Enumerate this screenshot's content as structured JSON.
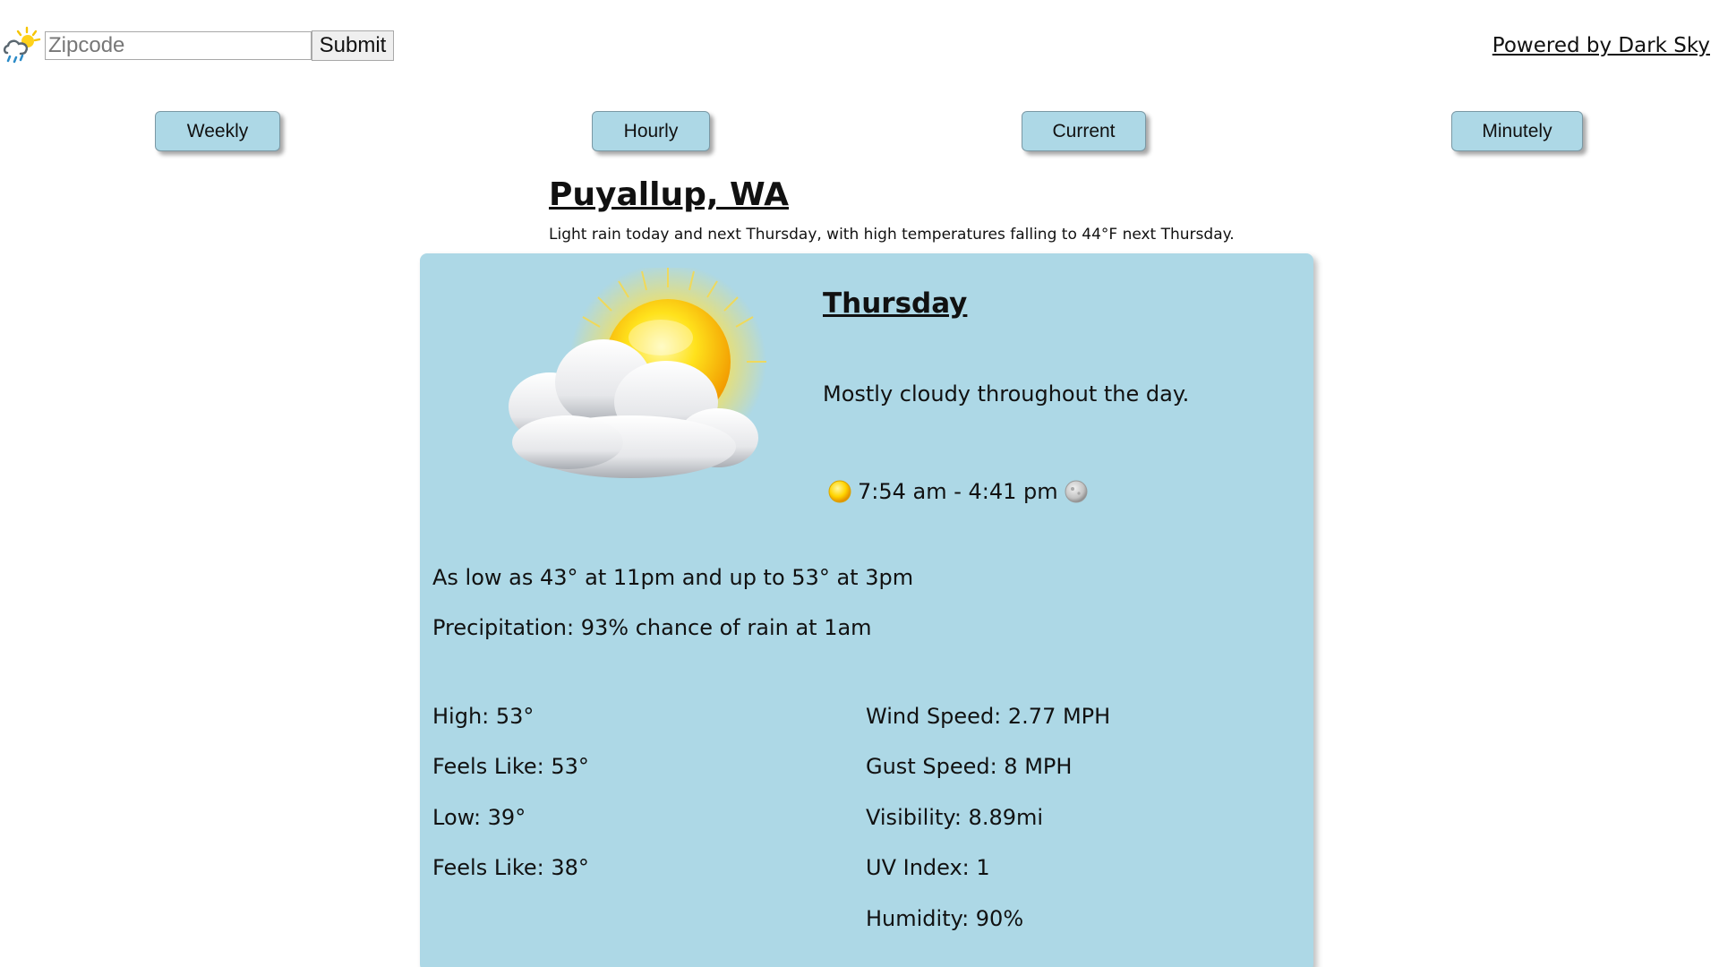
{
  "search": {
    "placeholder": "Zipcode",
    "value": "",
    "submit_label": "Submit"
  },
  "attribution": "Powered by Dark Sky",
  "nav": {
    "weekly": "Weekly",
    "hourly": "Hourly",
    "current": "Current",
    "minutely": "Minutely"
  },
  "location": "Puyallup, WA",
  "summary": "Light rain today and next Thursday, with high temperatures falling to 44°F next Thursday.",
  "day": {
    "name": "Thursday",
    "description": "Mostly cloudy throughout the day.",
    "sun_times": "7:54 am - 4:41 pm",
    "low_high": "As low as 43° at 11pm and up to 53° at 3pm",
    "precipitation": "Precipitation: 93% chance of rain at 1am",
    "high": "High: 53°",
    "high_feels": "Feels Like: 53°",
    "low": "Low: 39°",
    "low_feels": "Feels Like: 38°",
    "wind": "Wind Speed: 2.77 MPH",
    "gust": "Gust Speed: 8 MPH",
    "visibility": "Visibility: 8.89mi",
    "uv": "UV Index: 1",
    "humidity": "Humidity: 90%"
  },
  "icons": {
    "logo": "rain-sun-cloud-icon",
    "weather": "partly-cloudy-day-icon",
    "sunrise": "sun-icon",
    "sunset": "moon-icon"
  },
  "colors": {
    "card_background": "#add8e6",
    "button_background": "#add8e6",
    "page_background": "#ffffff"
  }
}
